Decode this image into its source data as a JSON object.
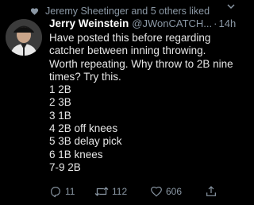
{
  "social_context": {
    "text": "Jeremy Sheetinger and 5 others liked",
    "icon": "heart-icon"
  },
  "author": {
    "display_name": "Jerry Weinstein",
    "handle": "@JWonCATCH...",
    "separator": "·",
    "time": "14h"
  },
  "tweet": {
    "body": "Have posted this before regarding catcher between inning throwing. Worth repeating. Why throw to 2B nine times? Try this.\n1 2B\n2 3B\n3 1B\n4 2B off knees\n5 3B delay pick\n6 1B knees\n7-9 2B"
  },
  "actions": {
    "reply_count": "11",
    "retweet_count": "112",
    "like_count": "606"
  },
  "colors": {
    "background": "#000000",
    "text": "#e6e6e6",
    "muted": "#8b98a5"
  }
}
